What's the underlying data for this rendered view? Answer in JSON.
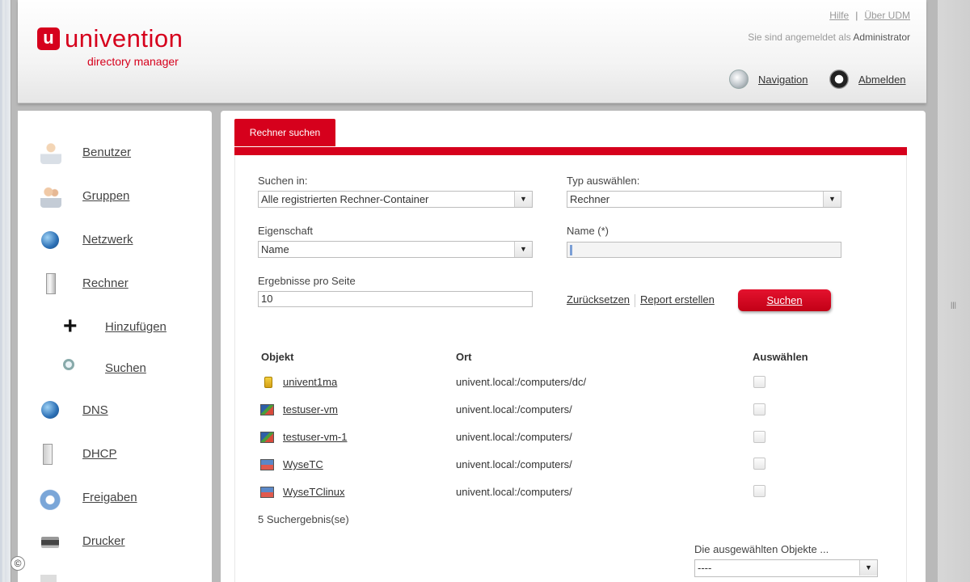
{
  "header": {
    "logo_mark": "u",
    "logo_name": "univention",
    "logo_sub": "directory manager",
    "help_link": "Hilfe",
    "about_link": "Über UDM",
    "logged_in_prefix": "Sie sind angemeldet als",
    "logged_in_user": "Administrator",
    "navigation_label": "Navigation",
    "logout_label": "Abmelden"
  },
  "sidebar": {
    "items": [
      {
        "label": "Benutzer",
        "icon": "user-icon"
      },
      {
        "label": "Gruppen",
        "icon": "group-icon"
      },
      {
        "label": "Netzwerk",
        "icon": "network-icon"
      },
      {
        "label": "Rechner",
        "icon": "computer-icon"
      },
      {
        "label": "Hinzufügen",
        "icon": "plus-icon"
      },
      {
        "label": "Suchen",
        "icon": "search-icon"
      },
      {
        "label": "DNS",
        "icon": "dns-icon"
      },
      {
        "label": "DHCP",
        "icon": "dhcp-icon"
      },
      {
        "label": "Freigaben",
        "icon": "share-icon"
      },
      {
        "label": "Drucker",
        "icon": "printer-icon"
      }
    ]
  },
  "main": {
    "tab_label": "Rechner suchen",
    "form": {
      "search_in_label": "Suchen in:",
      "search_in_value": "Alle registrierten Rechner-Container",
      "type_label": "Typ auswählen:",
      "type_value": "Rechner",
      "property_label": "Eigenschaft",
      "property_value": "Name",
      "name_label": "Name (*)",
      "name_value": "",
      "results_label": "Ergebnisse pro Seite",
      "results_value": "10",
      "reset_label": "Zurücksetzen",
      "report_label": "Report erstellen",
      "search_button": "Suchen"
    },
    "table": {
      "columns": [
        "Objekt",
        "Ort",
        "Auswählen"
      ],
      "rows": [
        {
          "object": "univent1ma",
          "location": "univent.local:/computers/dc/",
          "icon": "server-icon"
        },
        {
          "object": "testuser-vm",
          "location": "univent.local:/computers/",
          "icon": "windows-pc-icon"
        },
        {
          "object": "testuser-vm-1",
          "location": "univent.local:/computers/",
          "icon": "windows-pc-icon"
        },
        {
          "object": "WyseTC",
          "location": "univent.local:/computers/",
          "icon": "thin-client-icon"
        },
        {
          "object": "WyseTClinux",
          "location": "univent.local:/computers/",
          "icon": "thin-client-icon"
        }
      ]
    },
    "result_count": "5 Suchergebnis(se)",
    "selected_objects_label": "Die ausgewählten Objekte ...",
    "selected_objects_value": "----"
  },
  "colors": {
    "accent": "#d6001c"
  },
  "copyright": "©"
}
